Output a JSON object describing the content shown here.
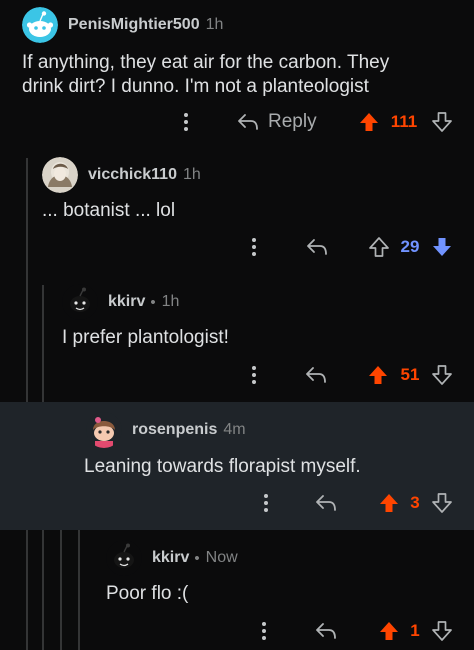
{
  "colors": {
    "background": "#0b0b0c",
    "highlight": "#1f2429",
    "upvote": "#ff4500",
    "downvote": "#7193ff",
    "thread_line": "#343536"
  },
  "icons": {
    "more": "vertical-dots-icon",
    "reply": "reply-arrow-icon",
    "upvote": "upvote-arrow-icon",
    "downvote": "downvote-arrow-icon"
  },
  "comments": [
    {
      "username": "PenisMightier500",
      "time": "1h",
      "body": "If anything, they eat air for the carbon. They drink dirt? I dunno. I'm not a planteologist",
      "reply_label": "Reply",
      "score": "111",
      "vote": "up",
      "avatar": "reddit-snoo-avatar"
    },
    {
      "username": "vicchick110",
      "time": "1h",
      "body": "... botanist ... lol",
      "score": "29",
      "vote": "down",
      "avatar": "user-photo-avatar"
    },
    {
      "username": "kkirv",
      "separator": "•",
      "time": "1h",
      "body": "I prefer plantologist!",
      "score": "51",
      "vote": "up",
      "avatar": "snoo-avatar"
    },
    {
      "username": "rosenpenis",
      "time": "4m",
      "body": "Leaning towards florapist myself.",
      "score": "3",
      "vote": "up",
      "highlighted": true,
      "avatar": "snoo-avatar"
    },
    {
      "username": "kkirv",
      "separator": "•",
      "time": "Now",
      "body": "Poor flo :(",
      "score": "1",
      "vote": "up",
      "avatar": "snoo-avatar"
    }
  ]
}
